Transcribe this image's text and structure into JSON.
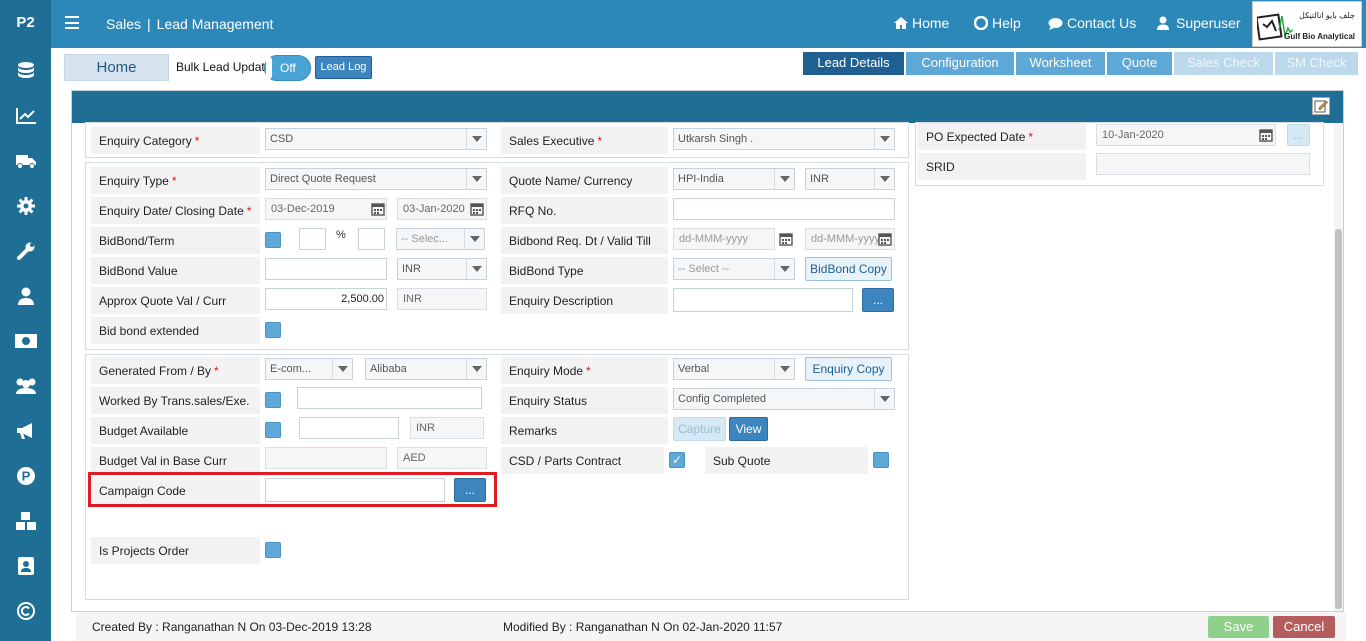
{
  "sidebar": {
    "logo": "P2",
    "icons": [
      "database-icon",
      "chart-line-icon",
      "truck-icon",
      "gear-icon",
      "wrench-icon",
      "user-icon",
      "money-icon",
      "users-icon",
      "bullhorn-icon",
      "p-circle-icon",
      "cubes-icon",
      "contact-book-icon",
      "copyright-icon"
    ]
  },
  "header": {
    "module": "Sales",
    "page": "Lead Management",
    "nav": {
      "home": "Home",
      "help": "Help",
      "contact": "Contact Us",
      "user": "Superuser"
    },
    "brand": {
      "arabic": "جلف بايو انالتيكل",
      "name": "Gulf Bio Analytical"
    }
  },
  "toolbar": {
    "home": "Home",
    "bulk_label": "Bulk Lead Update",
    "toggle": "Off",
    "lead_log": "Lead Log"
  },
  "tabs": [
    {
      "label": "Lead Details",
      "state": "active"
    },
    {
      "label": "Configuration",
      "state": "enabled"
    },
    {
      "label": "Worksheet",
      "state": "enabled"
    },
    {
      "label": "Quote",
      "state": "enabled"
    },
    {
      "label": "Sales Check",
      "state": "disabled"
    },
    {
      "label": "SM Check",
      "state": "disabled"
    }
  ],
  "form": {
    "enquiry_category": {
      "label": "Enquiry Category",
      "value": "CSD"
    },
    "sales_executive": {
      "label": "Sales Executive",
      "value": "Utkarsh Singh ."
    },
    "enquiry_type": {
      "label": "Enquiry Type",
      "value": "Direct Quote Request"
    },
    "quote_name": {
      "label": "Quote Name/ Currency",
      "value": "HPI-India",
      "currency": "INR"
    },
    "enquiry_date": {
      "label": "Enquiry Date/ Closing Date",
      "date": "03-Dec-2019",
      "closing": "03-Jan-2020"
    },
    "rfq": {
      "label": "RFQ No.",
      "value": ""
    },
    "bidbond_term": {
      "label": "BidBond/Term",
      "percent": "%",
      "term_placeholder": "-- Selec..."
    },
    "bidbond_req": {
      "label": "Bidbond Req. Dt / Valid Till",
      "placeholder1": "dd-MMM-yyyy",
      "placeholder2": "dd-MMM-yyyy"
    },
    "bidbond_value": {
      "label": "BidBond Value",
      "currency": "INR"
    },
    "bidbond_type": {
      "label": "BidBond Type",
      "placeholder": "-- Select --",
      "copy_btn": "BidBond Copy"
    },
    "approx_quote": {
      "label": "Approx Quote Val / Curr",
      "value": "2,500.00",
      "currency": "INR"
    },
    "enquiry_description": {
      "label": "Enquiry Description",
      "btn": "..."
    },
    "bid_bond_extended": {
      "label": "Bid bond extended"
    },
    "generated_from": {
      "label": "Generated From / By",
      "from": "E-com...",
      "by": "Alibaba"
    },
    "enquiry_mode": {
      "label": "Enquiry Mode",
      "value": "Verbal",
      "copy_btn": "Enquiry Copy"
    },
    "worked_by": {
      "label": "Worked By Trans.sales/Exe."
    },
    "enquiry_status": {
      "label": "Enquiry Status",
      "value": "Config Completed"
    },
    "budget_available": {
      "label": "Budget Available",
      "currency": "INR"
    },
    "remarks": {
      "label": "Remarks",
      "capture": "Capture",
      "view": "View"
    },
    "budget_base": {
      "label": "Budget Val in Base Curr",
      "currency": "AED"
    },
    "csd_parts": {
      "label": "CSD / Parts Contract",
      "checked": true
    },
    "sub_quote": {
      "label": "Sub Quote"
    },
    "campaign_code": {
      "label": "Campaign Code",
      "btn": "..."
    },
    "projects_order": {
      "label": "Is Projects Order"
    },
    "po_expected": {
      "label": "PO Expected Date",
      "value": "10-Jan-2020",
      "btn": "..."
    },
    "srid": {
      "label": "SRID",
      "value": ""
    }
  },
  "footer": {
    "created_prefix": "Created By :",
    "created": "Ranganathan N On 03-Dec-2019 13:28",
    "modified_prefix": "Modified By :",
    "modified": "Ranganathan N On 02-Jan-2020 11:57",
    "save": "Save",
    "cancel": "Cancel"
  }
}
